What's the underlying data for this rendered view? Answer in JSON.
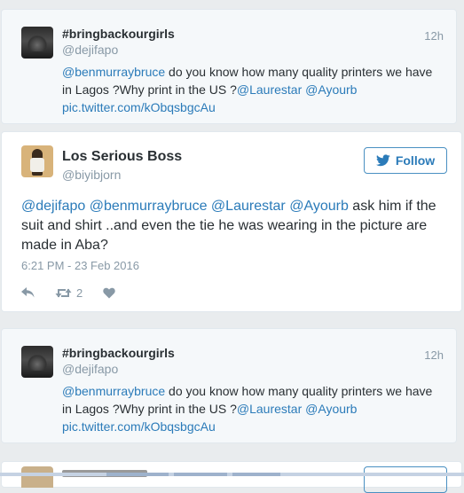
{
  "context_tweet_1": {
    "name": "#bringbackourgirls",
    "handle": "@dejifapo",
    "time": "12h",
    "mention": "@benmurraybruce",
    "text_1": " do you know how many quality printers we have in Lagos ?Why print in the US ?",
    "mention_2": "@Laurestar",
    "mention_3": "@Ayourb",
    "link": "pic.twitter.com/kObqsbgcAu"
  },
  "main_tweet": {
    "name": "Los Serious Boss",
    "handle": "@biyibjorn",
    "follow_label": "Follow",
    "mentions": "@dejifapo @benmurraybruce @Laurestar @Ayourb",
    "text": " ask him if the suit and shirt ..and even the tie he was wearing in the picture are made in Aba?",
    "date": "6:21 PM - 23 Feb 2016",
    "retweet_count": "2"
  },
  "context_tweet_2": {
    "name": "#bringbackourgirls",
    "handle": "@dejifapo",
    "time": "12h",
    "mention": "@benmurraybruce",
    "text_1": " do you know how many quality printers we have in Lagos ?Why print in the US ?",
    "mention_2": "@Laurestar",
    "mention_3": "@Ayourb",
    "link": "pic.twitter.com/kObqsbgcAu"
  },
  "colors": {
    "link": "#2b7bb9",
    "muted": "#8899a6",
    "text": "#292f33",
    "context_bg": "#f5f8fa",
    "border": "#e1e8ed"
  },
  "icons": {
    "reply": "reply-icon",
    "retweet": "retweet-icon",
    "like": "heart-icon",
    "follow": "twitter-bird-icon"
  }
}
